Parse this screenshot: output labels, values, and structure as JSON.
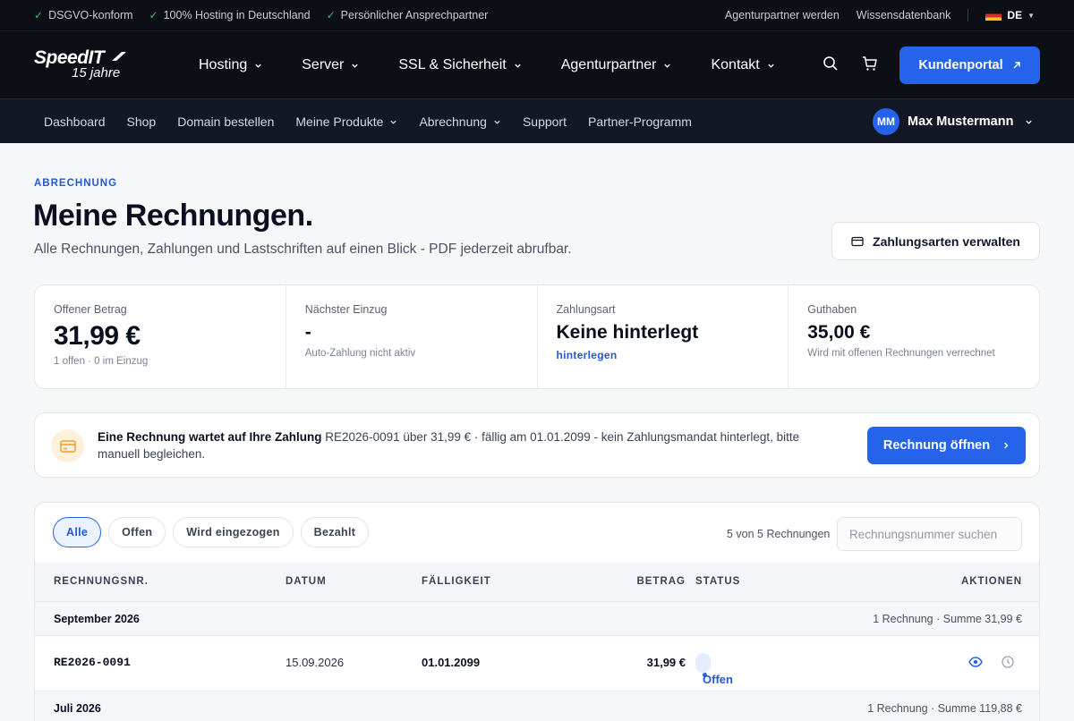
{
  "topbar": {
    "usps": [
      "DSGVO-konform",
      "100% Hosting in Deutschland",
      "Persönlicher Ansprechpartner"
    ],
    "links": [
      "Agenturpartner werden",
      "Wissensdatenbank"
    ],
    "language": "DE"
  },
  "logo": {
    "line1": "SpeedIT",
    "line2": "15 jahre"
  },
  "mainnav": {
    "items": [
      "Hosting",
      "Server",
      "SSL & Sicherheit",
      "Agenturpartner",
      "Kontakt"
    ],
    "portal_label": "Kundenportal"
  },
  "subnav": {
    "items": [
      "Dashboard",
      "Shop",
      "Domain bestellen",
      "Meine Produkte",
      "Abrechnung",
      "Support",
      "Partner-Programm"
    ],
    "user_initials": "MM",
    "user_name": "Max Mustermann"
  },
  "header": {
    "eyebrow": "ABRECHNUNG",
    "title": "Meine Rechnungen.",
    "subtitle": "Alle Rechnungen, Zahlungen und Lastschriften auf einen Blick - PDF jederzeit abrufbar.",
    "manage_label": "Zahlungsarten verwalten"
  },
  "stats": {
    "open": {
      "label": "Offener Betrag",
      "value": "31,99 €",
      "note": "1 offen · 0 im Einzug"
    },
    "next": {
      "label": "Nächster Einzug",
      "value": "-",
      "note": "Auto-Zahlung nicht aktiv"
    },
    "method": {
      "label": "Zahlungsart",
      "value": "Keine hinterlegt",
      "link": "hinterlegen"
    },
    "credit": {
      "label": "Guthaben",
      "value": "35,00 €",
      "note": "Wird mit offenen Rechnungen verrechnet"
    }
  },
  "alert": {
    "strong": "Eine Rechnung wartet auf Ihre Zahlung",
    "text": " RE2026-0091 über 31,99 € · fällig am 01.01.2099 - kein Zahlungsmandat hinterlegt, bitte manuell begleichen.",
    "button": "Rechnung öffnen"
  },
  "table": {
    "filters": [
      "Alle",
      "Offen",
      "Wird eingezogen",
      "Bezahlt"
    ],
    "active_filter": "Alle",
    "count": "5 von 5 Rechnungen",
    "search_placeholder": "Rechnungsnummer suchen",
    "columns": [
      "RECHNUNGSNR.",
      "DATUM",
      "FÄLLIGKEIT",
      "BETRAG",
      "STATUS",
      "AKTIONEN"
    ],
    "groups": [
      {
        "name": "September 2026",
        "summary": "1 Rechnung · Summe 31,99 €",
        "rows": [
          {
            "number": "RE2026-0091",
            "date": "15.09.2026",
            "due": "01.01.2099",
            "amount": "31,99 €",
            "status": "Offen"
          }
        ]
      },
      {
        "name": "Juli 2026",
        "summary": "1 Rechnung · Summe 119,88 €",
        "rows": []
      }
    ]
  },
  "colors": {
    "accent": "#2563eb",
    "nav_bg": "#0d0f16",
    "subnav_bg": "#141725"
  }
}
